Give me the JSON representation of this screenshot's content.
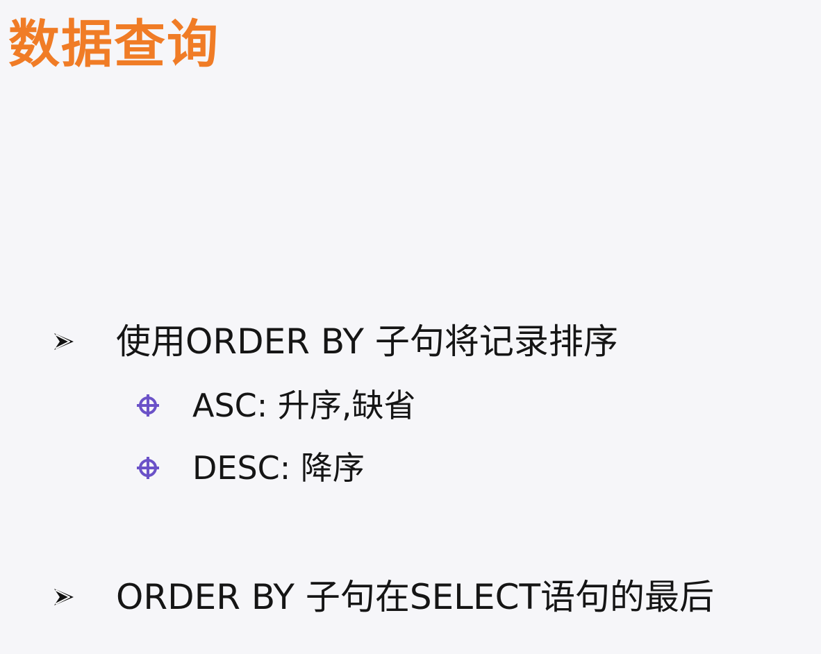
{
  "slide": {
    "title": "数据查询",
    "colors": {
      "background": "#f6f6f9",
      "title": "#f07c26",
      "text": "#151515",
      "arrow": "#111111",
      "sub_bullet": "#6b52c8"
    },
    "bullets": [
      {
        "icon": "arrow-bullet-icon",
        "text": "使用ORDER BY 子句将记录排序",
        "children": [
          {
            "icon": "crosshair-bullet-icon",
            "text": "ASC: 升序,缺省"
          },
          {
            "icon": "crosshair-bullet-icon",
            "text": "DESC: 降序"
          }
        ]
      },
      {
        "icon": "arrow-bullet-icon",
        "text": "ORDER BY 子句在SELECT语句的最后"
      }
    ]
  }
}
